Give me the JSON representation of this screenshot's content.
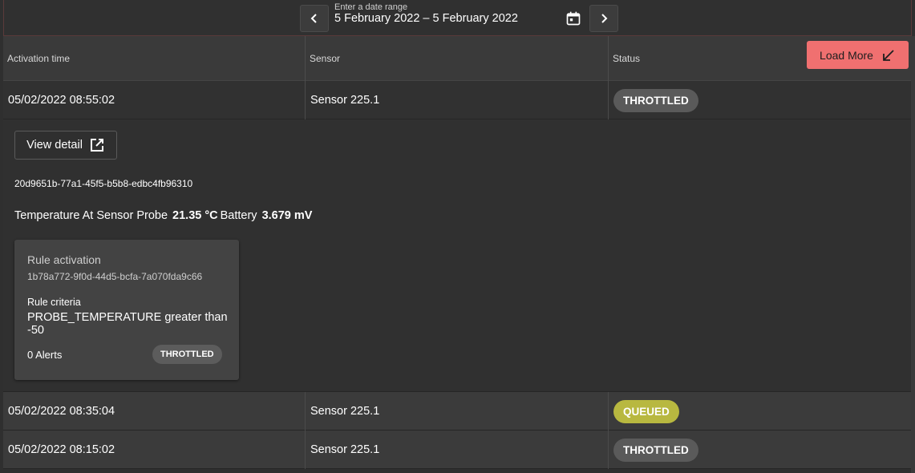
{
  "date_range": {
    "label": "Enter a date range",
    "value": "5 February 2022 – 5 February 2022"
  },
  "toolbar": {
    "prev_icon": "chevron-left-icon",
    "next_icon": "chevron-right-icon",
    "calendar_icon": "calendar-icon"
  },
  "table": {
    "headers": {
      "activation_time": "Activation time",
      "sensor": "Sensor",
      "status": "Status"
    },
    "load_more_label": "Load More",
    "rows": [
      {
        "time": "05/02/2022 08:55:02",
        "sensor": "Sensor 225.1",
        "status": "THROTTLED"
      },
      {
        "time": "05/02/2022 08:35:04",
        "sensor": "Sensor 225.1",
        "status": "QUEUED"
      },
      {
        "time": "05/02/2022 08:15:02",
        "sensor": "Sensor 225.1",
        "status": "THROTTLED"
      }
    ]
  },
  "detail": {
    "view_detail_label": "View detail",
    "uuid": "20d9651b-77a1-45f5-b5b8-edbc4fb96310",
    "temperature_label": "Temperature At Sensor Probe",
    "temperature_value": "21.35 °C",
    "battery_label": "Battery",
    "battery_value": "3.679 mV",
    "rule": {
      "title": "Rule activation",
      "id": "1b78a772-9f0d-44d5-bcfa-7a070fda9c66",
      "criteria_label": "Rule criteria",
      "criteria": "PROBE_TEMPERATURE greater than -50",
      "alerts": "0 Alerts",
      "status": "THROTTLED"
    }
  },
  "colors": {
    "load_more": "#f07070",
    "queued": "#b8b840",
    "throttled": "#5a5a5a"
  }
}
